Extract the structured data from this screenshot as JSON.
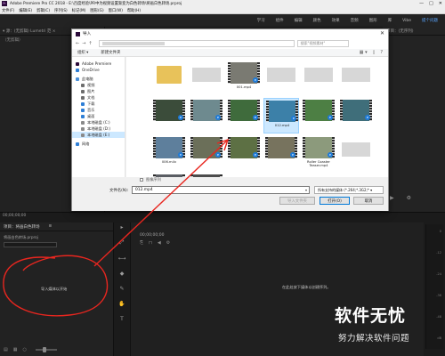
{
  "app": {
    "title": "Adobe Premiere Pro CC 2018 - E:\\百度经验\\PR中为视频设置渐变为白色转场\\将画白色转场.prproj",
    "window_controls": [
      "—",
      "□",
      "✕"
    ],
    "menu": [
      "文件(F)",
      "编辑(E)",
      "剪辑(C)",
      "序列(S)",
      "标记(M)",
      "图形(G)",
      "窗口(W)",
      "帮助(H)"
    ],
    "workspaces": [
      "学习",
      "组件",
      "编辑",
      "颜色",
      "效果",
      "音频",
      "图形",
      "库",
      "Vibe",
      "提个问题"
    ],
    "active_workspace_index": 9,
    "accent_color": "#5aa6ff"
  },
  "left_panel": {
    "header": "▾ 源：(无剪辑)    Lumetri 范 ×",
    "subheader": "（无剪辑）"
  },
  "right_panel": {
    "header": "节目：(无序列)",
    "controls": [
      "▶",
      "⚙"
    ]
  },
  "lower": {
    "timecode_left": "00;00;00;00"
  },
  "project_panel": {
    "tabs": [
      "项目：将画白色转场",
      "≡"
    ],
    "file": "将画白色转场.prproj",
    "import_hint": "导入媒体以开始",
    "bottom_tools": [
      "▤",
      "▦",
      "○"
    ]
  },
  "tools": [
    "▸",
    "⤢",
    "⟷",
    "◆",
    "✎",
    "✋",
    "T"
  ],
  "timeline": {
    "timecode": "00;00;00;00",
    "icons": [
      "⎘",
      "⊓",
      "◀",
      "⚙"
    ],
    "empty_hint": "在此处放下媒体以创建序列。"
  },
  "meter": {
    "scale": [
      "0",
      "-12",
      "-24",
      "-36",
      "-48",
      "dB"
    ]
  },
  "dialog": {
    "title": "导入",
    "close": "✕",
    "nav_back": "←",
    "nav_forward": "→",
    "nav_up": "↑",
    "search_placeholder": "搜索\"视频素材\"",
    "toolbar": {
      "organize": "组织 ▾",
      "new_folder": "新建文件夹",
      "view_icons": [
        "▦ ▾",
        "▯",
        "?"
      ]
    },
    "nav_items": [
      {
        "label": "Adobe Premiere",
        "color": "#2b0b3a",
        "indent": false
      },
      {
        "label": "OneDrive",
        "color": "#2f7fd6",
        "indent": false
      },
      {
        "label": "此电脑",
        "color": "#4a90d9",
        "indent": false
      },
      {
        "label": "视频",
        "color": "#6d6d6d",
        "indent": true
      },
      {
        "label": "图片",
        "color": "#6d6d6d",
        "indent": true
      },
      {
        "label": "文档",
        "color": "#6d6d6d",
        "indent": true
      },
      {
        "label": "下载",
        "color": "#2f7fd6",
        "indent": true
      },
      {
        "label": "音乐",
        "color": "#2f7fd6",
        "indent": true
      },
      {
        "label": "桌面",
        "color": "#2f7fd6",
        "indent": true
      },
      {
        "label": "本地磁盘 (C:)",
        "color": "#8a8a8a",
        "indent": true
      },
      {
        "label": "本地磁盘 (D:)",
        "color": "#8a8a8a",
        "indent": true
      },
      {
        "label": "本地磁盘 (E:)",
        "color": "#8a8a8a",
        "indent": true,
        "selected": true
      },
      {
        "label": "网络",
        "color": "#2f7fd6",
        "indent": false
      }
    ],
    "files": [
      {
        "name": "",
        "kind": "folder"
      },
      {
        "name": "",
        "kind": "blur"
      },
      {
        "name": "001.mp4",
        "kind": "video",
        "tone": "#7a7a72"
      },
      {
        "name": "",
        "kind": "blur"
      },
      {
        "name": "",
        "kind": "blur"
      },
      {
        "name": "",
        "kind": "blur"
      },
      {
        "name": "",
        "kind": "video",
        "tone": "#3b4c3a"
      },
      {
        "name": "",
        "kind": "video",
        "tone": "#6e8a8f"
      },
      {
        "name": "",
        "kind": "video",
        "tone": "#3f6b3c"
      },
      {
        "name": "012.mp4",
        "kind": "video",
        "tone": "#3c80a8",
        "selected": true
      },
      {
        "name": "",
        "kind": "video",
        "tone": "#4d7f44"
      },
      {
        "name": "",
        "kind": "video",
        "tone": "#3f6e7a"
      },
      {
        "name": "006.m4v",
        "kind": "video",
        "tone": "#5e7f9c"
      },
      {
        "name": "",
        "kind": "video",
        "tone": "#6b6f59"
      },
      {
        "name": "",
        "kind": "video",
        "tone": "#5d7044"
      },
      {
        "name": "",
        "kind": "video",
        "tone": "#77735e"
      },
      {
        "name": "Roller Coaster Teaser.mp4",
        "kind": "video",
        "tone": "#8c9a7c"
      },
      {
        "name": "",
        "kind": "blur"
      },
      {
        "name": "Animation Reel.mp4",
        "kind": "video",
        "tone": "#5a5d63"
      },
      {
        "name": "",
        "kind": "video",
        "tone": "#4c4c4c"
      }
    ],
    "sequence_checkbox": "图像序列",
    "filename_label": "文件名(N):",
    "filename_value": "012.mp4",
    "filename_dropdown": "▾",
    "filetype_value": "所有支持的媒体 (*.264;*.3G2;* ▾",
    "buttons": {
      "import_folder": "导入文件夹",
      "open": "打开(O)",
      "cancel": "取消"
    }
  },
  "annotation": {
    "color": "#e8261f"
  },
  "watermark": {
    "logo": "软件无忧",
    "sub": "努力解决软件问题"
  }
}
